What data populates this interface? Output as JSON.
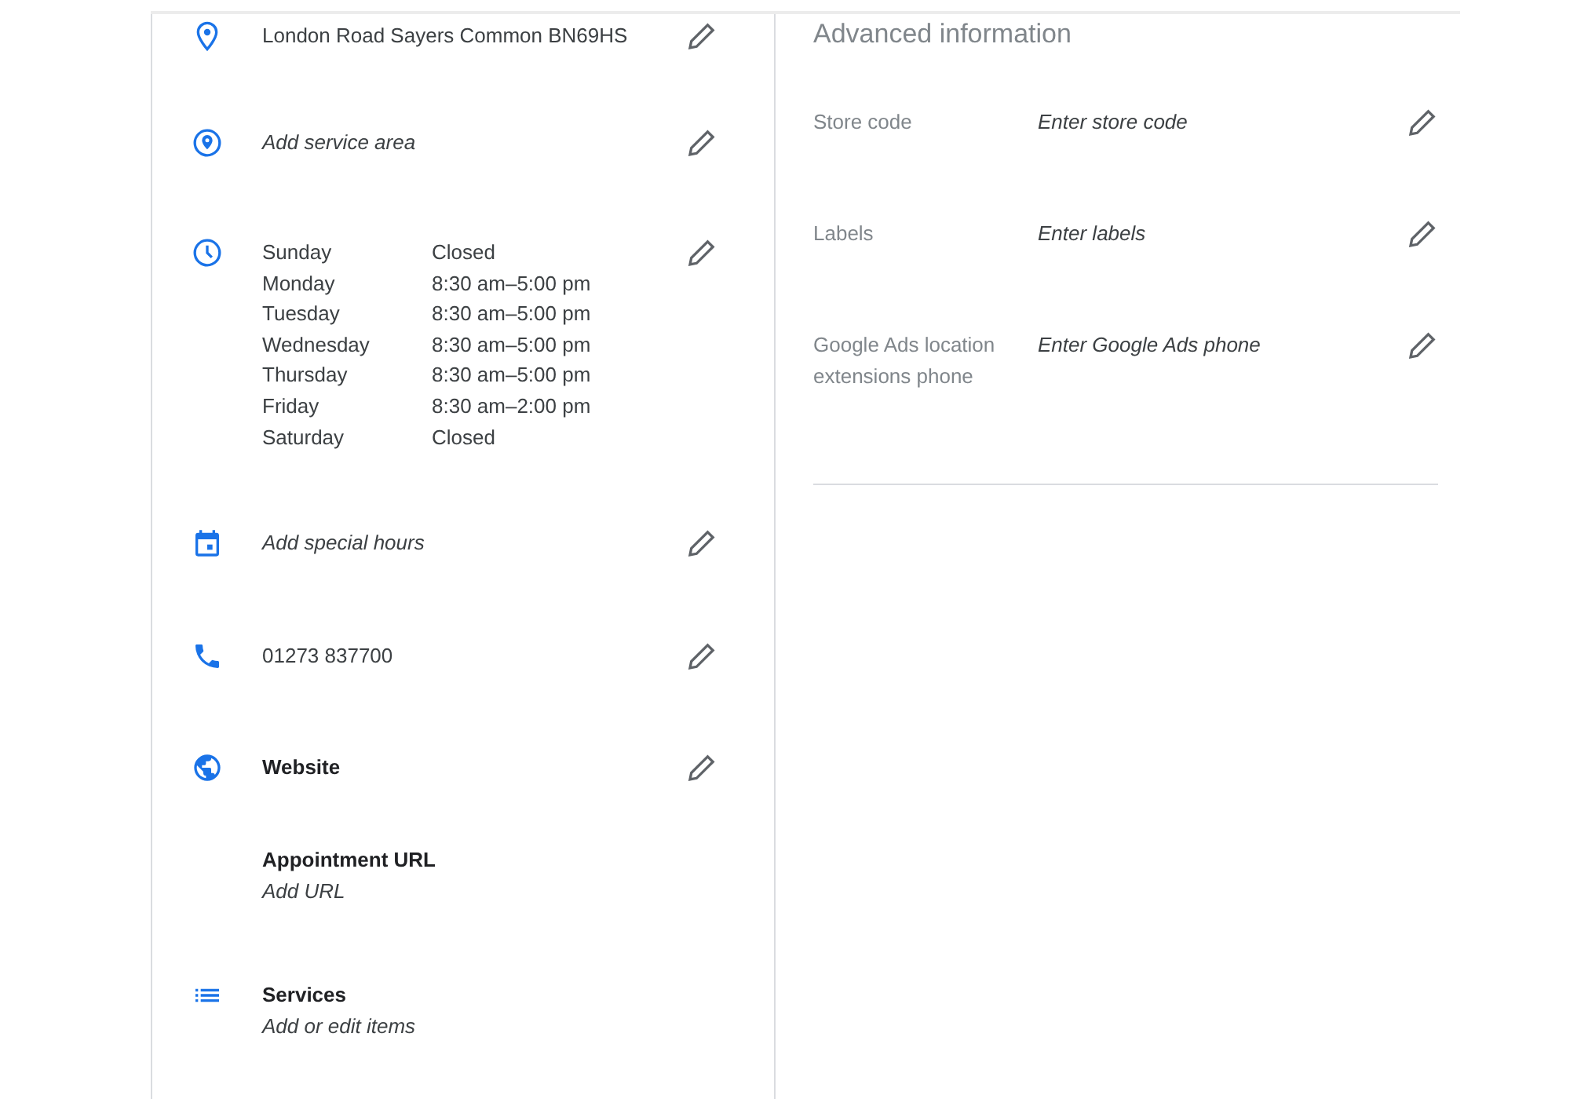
{
  "info_rows": [
    {
      "kind": "address",
      "editable": true,
      "text": "London Road Sayers Common BN69HS"
    },
    {
      "kind": "service_area",
      "editable": true,
      "placeholder": "Add service area"
    },
    {
      "kind": "hours",
      "editable": true,
      "days": [
        {
          "day": "Sunday",
          "hours": "Closed"
        },
        {
          "day": "Monday",
          "hours": "8:30 am–5:00 pm"
        },
        {
          "day": "Tuesday",
          "hours": "8:30 am–5:00 pm"
        },
        {
          "day": "Wednesday",
          "hours": "8:30 am–5:00 pm"
        },
        {
          "day": "Thursday",
          "hours": "8:30 am–5:00 pm"
        },
        {
          "day": "Friday",
          "hours": "8:30 am–2:00 pm"
        },
        {
          "day": "Saturday",
          "hours": "Closed"
        }
      ]
    },
    {
      "kind": "special_hours",
      "editable": true,
      "placeholder": "Add special hours"
    },
    {
      "kind": "phone",
      "editable": true,
      "text": "01273 837700"
    },
    {
      "kind": "website",
      "editable": true,
      "title": "Website"
    },
    {
      "kind": "appointment",
      "editable": false,
      "title": "Appointment URL",
      "placeholder": "Add URL"
    },
    {
      "kind": "services",
      "editable": false,
      "title": "Services",
      "placeholder": "Add or edit items"
    }
  ],
  "advanced": {
    "title": "Advanced information",
    "rows": [
      {
        "label": "Store code",
        "placeholder": "Enter store code"
      },
      {
        "label": "Labels",
        "placeholder": "Enter labels"
      },
      {
        "label": "Google Ads location extensions phone",
        "placeholder": "Enter Google Ads phone"
      }
    ]
  }
}
